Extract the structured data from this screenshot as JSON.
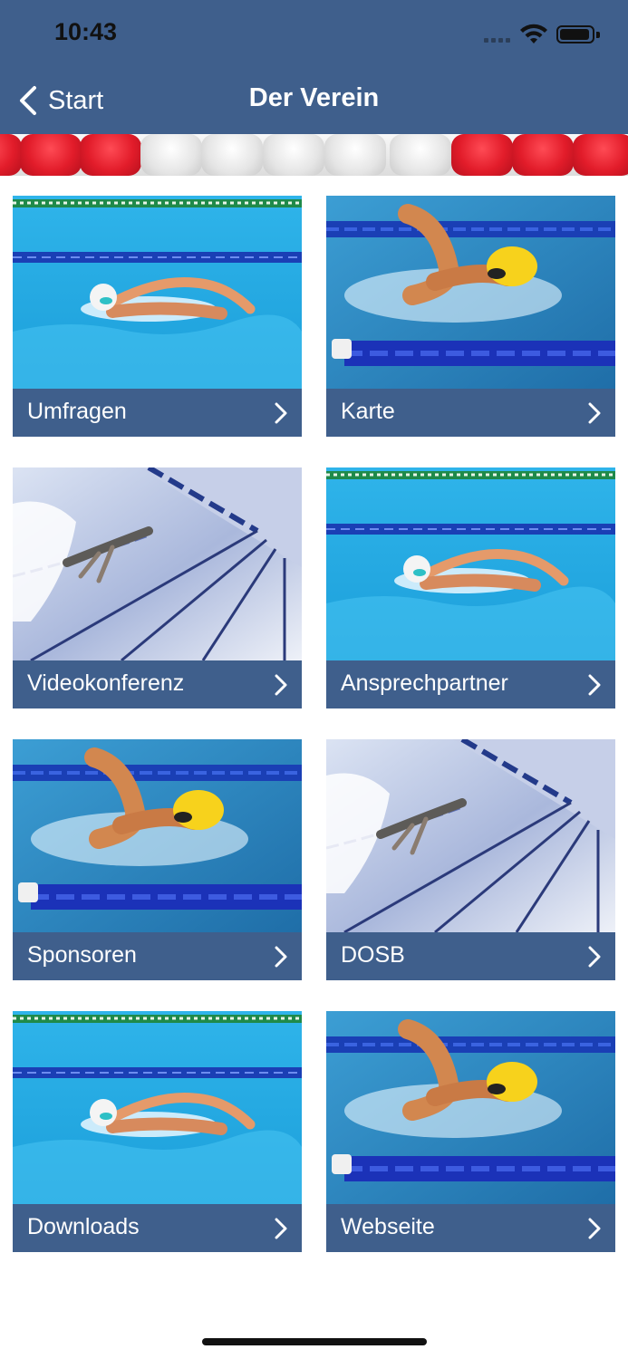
{
  "status_bar": {
    "time": "10:43"
  },
  "nav": {
    "back_label": "Start",
    "title": "Der Verein"
  },
  "tiles": [
    {
      "label": "Umfragen",
      "image": "swimmer-white-cap"
    },
    {
      "label": "Karte",
      "image": "swimmer-yellow-cap"
    },
    {
      "label": "Videokonferenz",
      "image": "underwater-lane"
    },
    {
      "label": "Ansprechpartner",
      "image": "swimmer-white-cap"
    },
    {
      "label": "Sponsoren",
      "image": "swimmer-yellow-cap"
    },
    {
      "label": "DOSB",
      "image": "underwater-lane"
    },
    {
      "label": "Downloads",
      "image": "swimmer-white-cap"
    },
    {
      "label": "Webseite",
      "image": "swimmer-yellow-cap"
    }
  ],
  "colors": {
    "nav_bar": "#3f5f8c",
    "caption_bar": "#3f5f8c",
    "pool_water": "#23a7e0",
    "lane_rope": "#1a3fb5"
  }
}
